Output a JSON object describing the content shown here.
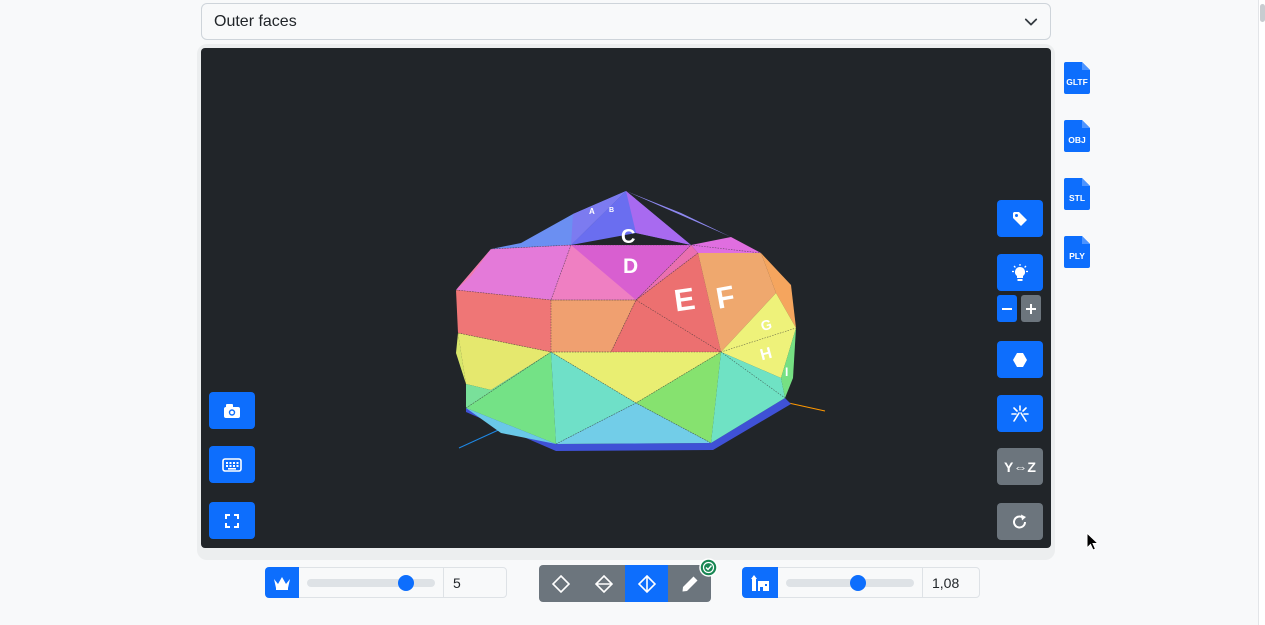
{
  "face_select": {
    "value": "Outer faces"
  },
  "viewer": {
    "labels": [
      "A",
      "B",
      "C",
      "D",
      "E",
      "F",
      "G",
      "H",
      "I"
    ],
    "right_buttons": {
      "label_toggle_icon": "tag-icon",
      "light_icon": "lightbulb-icon",
      "minus_icon": "minus-icon",
      "plus_icon": "plus-icon",
      "shape_icon": "hexagon-icon",
      "explode_icon": "sparkle-icon",
      "swap_axes_label": "Y⇔Z",
      "reset_icon": "rotate-icon"
    },
    "left_buttons": {
      "screenshot_icon": "camera-icon",
      "keyboard_icon": "keyboard-icon",
      "fullscreen_icon": "fullscreen-icon"
    }
  },
  "export": {
    "formats": [
      "GLTF",
      "OBJ",
      "STL",
      "PLY"
    ]
  },
  "controls": {
    "frequency": {
      "icon": "crown-icon",
      "value": "5",
      "slider_fraction": 0.77
    },
    "modes": [
      {
        "icon": "diamond-icon",
        "active": false
      },
      {
        "icon": "diamond-half-icon",
        "active": false
      },
      {
        "icon": "diamond-split-icon",
        "active": true
      },
      {
        "icon": "pencil-icon",
        "active": false
      }
    ],
    "height": {
      "icon": "building-icon",
      "value": "1,08",
      "slider_fraction": 0.56
    }
  },
  "colors": {
    "accent": "#0d6efd",
    "secondary": "#6c757d",
    "viewer_bg": "#212529",
    "success": "#198754"
  }
}
